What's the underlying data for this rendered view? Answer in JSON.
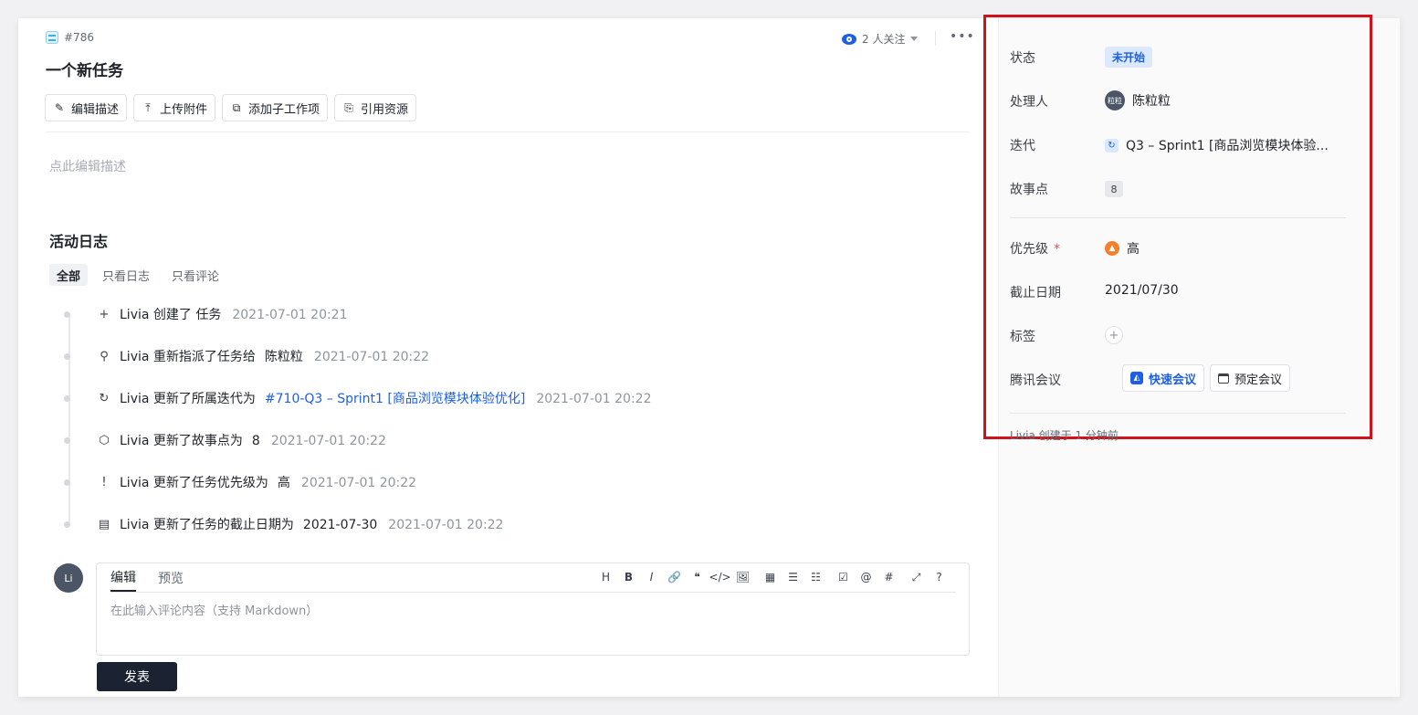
{
  "task": {
    "id": "#786",
    "title": "一个新任务"
  },
  "watch": {
    "label": "2 人关注",
    "more": "•••"
  },
  "toolbar": [
    "编辑描述",
    "上传附件",
    "添加子工作项",
    "引用资源"
  ],
  "description_placeholder": "点此编辑描述",
  "activity": {
    "title": "活动日志",
    "filters": [
      "全部",
      "只看日志",
      "只看评论"
    ],
    "logs": [
      {
        "icon": "plus-icon",
        "glyph": "+",
        "text": "Livia 创建了 任务",
        "value": "",
        "link": "",
        "time": "2021-07-01 20:21"
      },
      {
        "icon": "user-icon",
        "glyph": "⚲",
        "text": "Livia 重新指派了任务给",
        "value": "陈粒粒",
        "link": "",
        "time": "2021-07-01 20:22"
      },
      {
        "icon": "iteration-icon",
        "glyph": "↻",
        "text": "Livia 更新了所属迭代为",
        "value": "",
        "link": "#710-Q3 – Sprint1 [商品浏览模块体验优化]",
        "time": "2021-07-01 20:22"
      },
      {
        "icon": "cube-icon",
        "glyph": "⬡",
        "text": "Livia 更新了故事点为",
        "value": "8",
        "link": "",
        "time": "2021-07-01 20:22"
      },
      {
        "icon": "exclamation-icon",
        "glyph": "!",
        "text": "Livia 更新了任务优先级为",
        "value": "高",
        "link": "",
        "time": "2021-07-01 20:22"
      },
      {
        "icon": "calendar-icon",
        "glyph": "▤",
        "text": "Livia 更新了任务的截止日期为",
        "value": "2021-07-30",
        "link": "",
        "time": "2021-07-01 20:22"
      }
    ]
  },
  "comment": {
    "avatar": "Li",
    "tabs": [
      "编辑",
      "预览"
    ],
    "tools": [
      "H",
      "B",
      "I",
      "🔗",
      "❝",
      "</>",
      "🖼",
      "▦",
      "☰",
      "☷",
      "☑",
      "@",
      "#",
      "⤢",
      "?"
    ],
    "placeholder": "在此输入评论内容（支持 Markdown）",
    "submit": "发表"
  },
  "properties": {
    "status": {
      "label": "状态",
      "value": "未开始"
    },
    "assignee": {
      "label": "处理人",
      "avatar": "粒粒",
      "value": "陈粒粒"
    },
    "iteration": {
      "label": "迭代",
      "value": "Q3 – Sprint1 [商品浏览模块体验..."
    },
    "story_points": {
      "label": "故事点",
      "value": "8"
    },
    "priority": {
      "label": "优先级",
      "required": "*",
      "value": "高"
    },
    "due_date": {
      "label": "截止日期",
      "value": "2021/07/30"
    },
    "tags": {
      "label": "标签",
      "add": "+"
    },
    "meeting": {
      "label": "腾讯会议",
      "quick": "快速会议",
      "schedule": "预定会议"
    },
    "created": "Livia 创建于 1 分钟前"
  },
  "colors": {
    "accent": "#1d5fe6",
    "highlight_border": "#d0121b",
    "priority": "#f57e2d"
  }
}
